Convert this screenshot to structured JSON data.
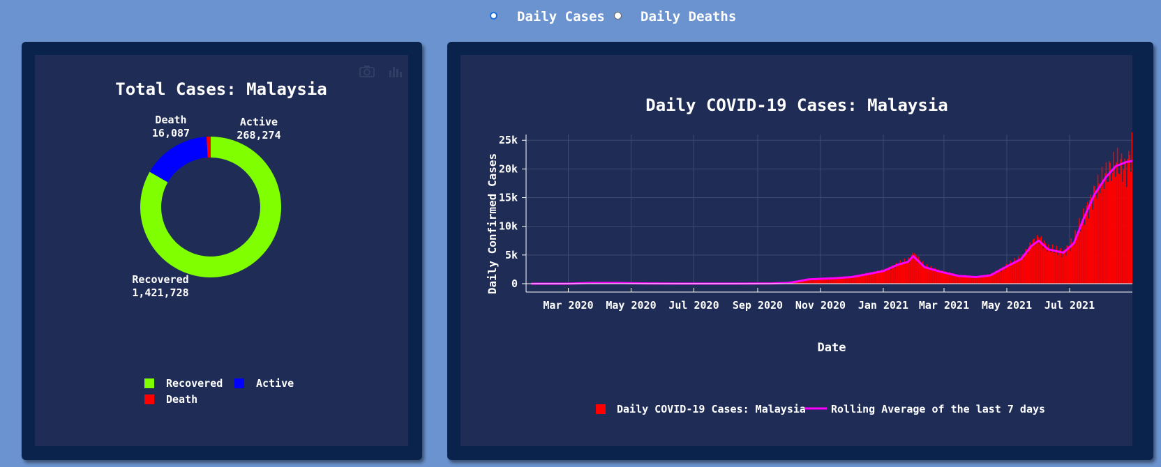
{
  "controls": {
    "options": [
      {
        "label": "Daily Cases",
        "selected": true
      },
      {
        "label": "Daily Deaths",
        "selected": false
      }
    ]
  },
  "colors": {
    "page_bg": "#6b93cf",
    "panel_bg": "#0a234d",
    "plot_bg": "#1f2c55",
    "recovered": "#7fff00",
    "active": "#0000ff",
    "death": "#ff0000",
    "bar": "#ff0000",
    "rolling": "#ff00ff"
  },
  "toolbar_icons": [
    "camera-icon",
    "bar-chart-icon"
  ],
  "chart_data": [
    {
      "type": "pie",
      "title": "Total Cases: Malaysia",
      "hole": true,
      "labels": [
        "Recovered",
        "Active",
        "Death"
      ],
      "values": [
        1421728,
        268274,
        16087
      ],
      "value_labels": [
        "1,421,728",
        "268,274",
        "16,087"
      ],
      "legend": [
        "Recovered",
        "Active",
        "Death"
      ],
      "legend_position": "bottom"
    },
    {
      "type": "bar",
      "title": "Daily COVID-19 Cases: Malaysia",
      "xlabel": "Date",
      "ylabel": "Daily Confirmed Cases",
      "x_ticks": [
        "Mar 2020",
        "May 2020",
        "Jul 2020",
        "Sep 2020",
        "Nov 2020",
        "Jan 2021",
        "Mar 2021",
        "May 2021",
        "Jul 2021"
      ],
      "y_ticks": [
        "0",
        "5k",
        "10k",
        "15k",
        "20k",
        "25k"
      ],
      "ylim": [
        0,
        26000
      ],
      "grid": true,
      "legend_position": "bottom",
      "series": [
        {
          "name": "Daily COVID-19 Cases: Malaysia",
          "type": "bar",
          "x": [
            "2020-01-25",
            "2020-03-01",
            "2020-03-20",
            "2020-04-15",
            "2020-05-15",
            "2020-06-15",
            "2020-07-15",
            "2020-08-15",
            "2020-09-15",
            "2020-09-30",
            "2020-10-10",
            "2020-10-20",
            "2020-11-01",
            "2020-11-15",
            "2020-12-01",
            "2020-12-15",
            "2021-01-01",
            "2021-01-15",
            "2021-01-25",
            "2021-01-30",
            "2021-02-10",
            "2021-02-25",
            "2021-03-15",
            "2021-04-01",
            "2021-04-15",
            "2021-05-01",
            "2021-05-15",
            "2021-05-25",
            "2021-06-01",
            "2021-06-10",
            "2021-06-25",
            "2021-07-05",
            "2021-07-15",
            "2021-07-25",
            "2021-08-05",
            "2021-08-15",
            "2021-08-25",
            "2021-08-31"
          ],
          "values": [
            0,
            5,
            150,
            150,
            40,
            20,
            10,
            15,
            60,
            150,
            450,
            800,
            900,
            1000,
            1200,
            1700,
            2300,
            3400,
            4000,
            5200,
            3000,
            2200,
            1400,
            1200,
            1500,
            3200,
            4500,
            7000,
            8000,
            6000,
            5500,
            7500,
            12000,
            16000,
            19000,
            21000,
            20000,
            24500
          ]
        },
        {
          "name": "Rolling Average of the last 7 days",
          "type": "line",
          "x": [
            "2020-01-25",
            "2020-03-01",
            "2020-03-20",
            "2020-04-15",
            "2020-05-15",
            "2020-06-15",
            "2020-07-15",
            "2020-08-15",
            "2020-09-15",
            "2020-09-30",
            "2020-10-10",
            "2020-10-20",
            "2020-11-01",
            "2020-11-15",
            "2020-12-01",
            "2020-12-15",
            "2021-01-01",
            "2021-01-15",
            "2021-01-25",
            "2021-01-30",
            "2021-02-10",
            "2021-02-25",
            "2021-03-15",
            "2021-04-01",
            "2021-04-15",
            "2021-05-01",
            "2021-05-15",
            "2021-05-25",
            "2021-06-01",
            "2021-06-10",
            "2021-06-25",
            "2021-07-05",
            "2021-07-15",
            "2021-07-25",
            "2021-08-05",
            "2021-08-15",
            "2021-08-25",
            "2021-08-31"
          ],
          "values": [
            0,
            5,
            120,
            140,
            50,
            20,
            10,
            15,
            50,
            130,
            400,
            750,
            850,
            950,
            1150,
            1600,
            2200,
            3300,
            3800,
            4800,
            2900,
            2100,
            1350,
            1150,
            1450,
            3000,
            4300,
            6600,
            7500,
            6000,
            5400,
            7000,
            11500,
            15500,
            18500,
            20500,
            21200,
            21400
          ]
        }
      ]
    }
  ]
}
